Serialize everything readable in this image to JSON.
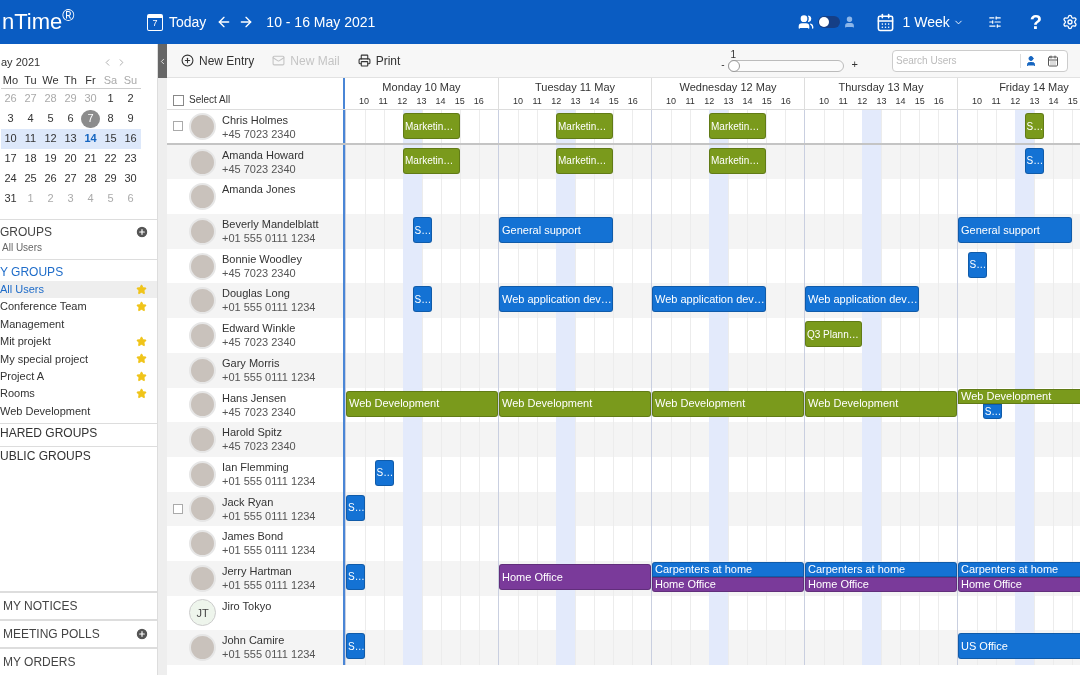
{
  "topbar": {
    "logo": "nTime$^{®}$",
    "today_icon_day": "7",
    "today": "Today",
    "range": "10 - 16 May 2021",
    "view_toggle": {
      "on": false
    },
    "period": "1 Week",
    "help": "?"
  },
  "mini_calendar": {
    "month": "ay 2021",
    "weekdays": [
      {
        "label": "Mo",
        "weekend": false
      },
      {
        "label": "Tu",
        "weekend": false
      },
      {
        "label": "We",
        "weekend": false
      },
      {
        "label": "Th",
        "weekend": false
      },
      {
        "label": "Fr",
        "weekend": false
      },
      {
        "label": "Sa",
        "weekend": true
      },
      {
        "label": "Su",
        "weekend": true
      }
    ],
    "weeks": [
      {
        "selected": false,
        "days": [
          {
            "day": "26",
            "kind": "other"
          },
          {
            "day": "27",
            "kind": "other"
          },
          {
            "day": "28",
            "kind": "other"
          },
          {
            "day": "29",
            "kind": "other"
          },
          {
            "day": "30",
            "kind": "other"
          },
          {
            "day": "1",
            "kind": "normal"
          },
          {
            "day": "2",
            "kind": "normal"
          }
        ]
      },
      {
        "selected": false,
        "days": [
          {
            "day": "3",
            "kind": "normal"
          },
          {
            "day": "4",
            "kind": "normal"
          },
          {
            "day": "5",
            "kind": "normal"
          },
          {
            "day": "6",
            "kind": "normal"
          },
          {
            "day": "7",
            "kind": "circled"
          },
          {
            "day": "8",
            "kind": "normal"
          },
          {
            "day": "9",
            "kind": "normal"
          }
        ]
      },
      {
        "selected": true,
        "days": [
          {
            "day": "10",
            "kind": "normal"
          },
          {
            "day": "11",
            "kind": "normal"
          },
          {
            "day": "12",
            "kind": "normal"
          },
          {
            "day": "13",
            "kind": "normal"
          },
          {
            "day": "14",
            "kind": "accent"
          },
          {
            "day": "15",
            "kind": "normal"
          },
          {
            "day": "16",
            "kind": "normal"
          }
        ]
      },
      {
        "selected": false,
        "days": [
          {
            "day": "17",
            "kind": "normal"
          },
          {
            "day": "18",
            "kind": "normal"
          },
          {
            "day": "19",
            "kind": "normal"
          },
          {
            "day": "20",
            "kind": "normal"
          },
          {
            "day": "21",
            "kind": "normal"
          },
          {
            "day": "22",
            "kind": "normal"
          },
          {
            "day": "23",
            "kind": "normal"
          }
        ]
      },
      {
        "selected": false,
        "days": [
          {
            "day": "24",
            "kind": "normal"
          },
          {
            "day": "25",
            "kind": "normal"
          },
          {
            "day": "26",
            "kind": "normal"
          },
          {
            "day": "27",
            "kind": "normal"
          },
          {
            "day": "28",
            "kind": "normal"
          },
          {
            "day": "29",
            "kind": "normal"
          },
          {
            "day": "30",
            "kind": "normal"
          }
        ]
      },
      {
        "selected": false,
        "days": [
          {
            "day": "31",
            "kind": "normal"
          },
          {
            "day": "1",
            "kind": "other"
          },
          {
            "day": "2",
            "kind": "other"
          },
          {
            "day": "3",
            "kind": "other"
          },
          {
            "day": "4",
            "kind": "other"
          },
          {
            "day": "5",
            "kind": "other"
          },
          {
            "day": "6",
            "kind": "other"
          }
        ]
      }
    ]
  },
  "current_group": {
    "title": "GROUPS",
    "subtitle": "All Users"
  },
  "my_groups": {
    "title": "Y GROUPS",
    "items": [
      {
        "label": "All Users",
        "selected": true,
        "starred": true
      },
      {
        "label": "Conference Team",
        "selected": false,
        "starred": true
      },
      {
        "label": "Management",
        "selected": false,
        "starred": false
      },
      {
        "label": "Mit projekt",
        "selected": false,
        "starred": true
      },
      {
        "label": "My special project",
        "selected": false,
        "starred": true
      },
      {
        "label": "Project A",
        "selected": false,
        "starred": true
      },
      {
        "label": "Rooms",
        "selected": false,
        "starred": true
      },
      {
        "label": "Web Development",
        "selected": false,
        "starred": false
      }
    ]
  },
  "other_groups": [
    "HARED GROUPS",
    "UBLIC GROUPS"
  ],
  "bottom_sections": [
    {
      "label": "MY NOTICES",
      "add": false
    },
    {
      "label": "MEETING POLLS",
      "add": true
    },
    {
      "label": "MY ORDERS",
      "add": false
    }
  ],
  "toolbar": {
    "buttons": [
      {
        "label": "New Entry",
        "kind": "add",
        "disabled": false
      },
      {
        "label": "New Mail",
        "kind": "mail",
        "disabled": true
      },
      {
        "label": "Print",
        "kind": "print",
        "disabled": false
      }
    ],
    "zoom": {
      "value": "1",
      "minus": "-",
      "plus": "+",
      "level": 0
    },
    "search": {
      "placeholder": "Search Users"
    }
  },
  "select_all": {
    "label": "Select All",
    "checked": false
  },
  "days": [
    {
      "name": "Monday 10 May",
      "hours": [
        "10",
        "11",
        "12",
        "13",
        "14",
        "15",
        "16"
      ]
    },
    {
      "name": "Tuesday 11 May",
      "hours": [
        "10",
        "11",
        "12",
        "13",
        "14",
        "15",
        "16"
      ]
    },
    {
      "name": "Wednesday 12 May",
      "hours": [
        "10",
        "11",
        "12",
        "13",
        "14",
        "15",
        "16"
      ]
    },
    {
      "name": "Thursday 13 May",
      "hours": [
        "10",
        "11",
        "12",
        "13",
        "14",
        "15",
        "16"
      ]
    },
    {
      "name": "Friday 14 May",
      "hours": [
        "10",
        "11",
        "12",
        "13",
        "14",
        "15"
      ]
    }
  ],
  "users": [
    {
      "name": "Chris Holmes",
      "phone": "+45 7023 2340",
      "pinned": true,
      "checked": false,
      "events": [
        {
          "title": "Marketin…",
          "color": "#7a9a1c"
        },
        {
          "title": "Marketin…",
          "color": "#7a9a1c"
        },
        {
          "title": "Marketin…",
          "color": "#7a9a1c"
        },
        {
          "title": "S…",
          "color": "#7a9a1c"
        }
      ]
    },
    {
      "name": "Amanda Howard",
      "phone": "+45 7023 2340",
      "pinned": false,
      "events": [
        {
          "title": "Marketin…",
          "color": "#7a9a1c"
        },
        {
          "title": "Marketin…",
          "color": "#7a9a1c"
        },
        {
          "title": "Marketin…",
          "color": "#7a9a1c"
        },
        {
          "title": "S…",
          "color": "#1472d4"
        }
      ]
    },
    {
      "name": "Amanda Jones",
      "pinned": false
    },
    {
      "name": "Beverly Mandelblatt",
      "phone": "+01 555 0111 1234",
      "pinned": false,
      "events": [
        {
          "title": "S…",
          "color": "#1472d4"
        },
        {
          "title": "General support",
          "color": "#1472d4"
        },
        {
          "title": "General support",
          "color": "#1472d4"
        }
      ]
    },
    {
      "name": "Bonnie Woodley",
      "phone": "+45 7023 2340",
      "pinned": false,
      "events": [
        {
          "title": "S…",
          "color": "#1472d4"
        }
      ]
    },
    {
      "name": "Douglas Long",
      "phone": "+01 555 0111 1234",
      "pinned": false,
      "events": [
        {
          "title": "S…",
          "color": "#1472d4"
        },
        {
          "title": "Web application dev…",
          "color": "#1472d4"
        },
        {
          "title": "Web application dev…",
          "color": "#1472d4"
        },
        {
          "title": "Web application dev…",
          "color": "#1472d4"
        }
      ]
    },
    {
      "name": "Edward Winkle",
      "phone": "+45 7023 2340",
      "pinned": false,
      "events": [
        {
          "title": "Q3 Plann…",
          "color": "#7a9a1c"
        }
      ]
    },
    {
      "name": "Gary Morris",
      "phone": "+01 555 0111 1234",
      "pinned": false
    },
    {
      "name": "Hans Jensen",
      "phone": "+45 7023 2340",
      "pinned": false,
      "events": [
        {
          "title": "Web Development",
          "color": "#7a9a1c"
        },
        {
          "title": "Web Development",
          "color": "#7a9a1c"
        },
        {
          "title": "Web Development",
          "color": "#7a9a1c"
        },
        {
          "title": "Web Development",
          "color": "#7a9a1c"
        },
        {
          "title": "Web Development",
          "color": "#7a9a1c"
        },
        {
          "title": "S…",
          "color": "#1472d4"
        }
      ]
    },
    {
      "name": "Harold Spitz",
      "phone": "+45 7023 2340",
      "pinned": false
    },
    {
      "name": "Ian Flemming",
      "phone": "+01 555 0111 1234",
      "pinned": false,
      "events": [
        {
          "title": "S…",
          "color": "#1472d4"
        }
      ]
    },
    {
      "name": "Jack Ryan",
      "phone": "+01 555 0111 1234",
      "pinned": false,
      "checked": false,
      "events": [
        {
          "title": "S…",
          "color": "#1472d4"
        }
      ]
    },
    {
      "name": "James Bond",
      "phone": "+01 555 0111 1234",
      "pinned": false
    },
    {
      "name": "Jerry Hartman",
      "phone": "+01 555 0111 1234",
      "pinned": false,
      "events": [
        {
          "title": "S…",
          "color": "#1472d4"
        },
        {
          "title": "Home Office",
          "color": "#7a3a9a"
        },
        {
          "title": "Carpenters at home",
          "color": "#1472d4"
        },
        {
          "title": "Home Office",
          "color": "#7a3a9a"
        },
        {
          "title": "Carpenters at home",
          "color": "#1472d4"
        },
        {
          "title": "Home Office",
          "color": "#7a3a9a"
        },
        {
          "title": "Carpenters at home",
          "color": "#1472d4"
        },
        {
          "title": "Home Office",
          "color": "#7a3a9a"
        }
      ]
    },
    {
      "name": "Jiro Tokyo",
      "initials": "JT",
      "pinned": false
    },
    {
      "name": "John Camire",
      "phone": "+01 555 0111 1234",
      "pinned": false,
      "events": [
        {
          "title": "S…",
          "color": "#1472d4"
        },
        {
          "title": "US Office",
          "color": "#1472d4"
        }
      ]
    }
  ]
}
